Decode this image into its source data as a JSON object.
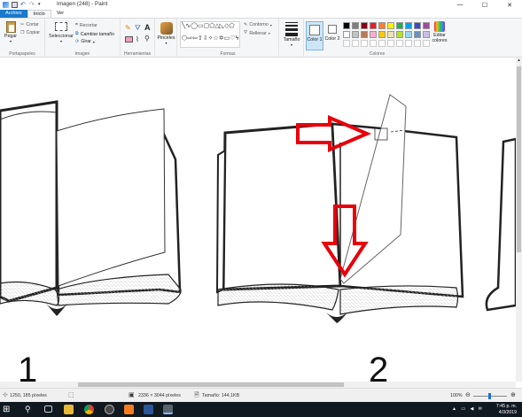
{
  "window": {
    "title": "Imagen (248) - Paint",
    "controls": {
      "minimize": "—",
      "maximize": "☐",
      "close": "✕"
    }
  },
  "tabs": {
    "file": "Archivo",
    "home": "Inicio",
    "view": "Ver"
  },
  "ribbon": {
    "clipboard": {
      "paste": "Pegar",
      "cut": "Cortar",
      "copy": "Copiar",
      "label": "Portapapeles"
    },
    "image": {
      "select": "Seleccionar",
      "crop": "Recortar",
      "resize": "Cambiar tamaño",
      "rotate": "Girar",
      "label": "Imagen"
    },
    "tools": {
      "label": "Herramientas"
    },
    "brushes": {
      "label": "Pinceles"
    },
    "shapes": {
      "outline": "Contorno",
      "fill": "Rellenar",
      "label": "Formas"
    },
    "size": {
      "label": "Tamaño"
    },
    "colors": {
      "color1": "Color 1",
      "color2": "Color 2",
      "edit": "Editar colores",
      "label": "Colores",
      "palette_row1": [
        "#000000",
        "#7f7f7f",
        "#880015",
        "#ed1c24",
        "#ff7f27",
        "#fff200",
        "#22b14c",
        "#00a2e8",
        "#3f48cc",
        "#a349a4"
      ],
      "palette_row2": [
        "#ffffff",
        "#c3c3c3",
        "#b97a57",
        "#ffaec9",
        "#ffc90e",
        "#efe4b0",
        "#b5e61d",
        "#99d9ea",
        "#7092be",
        "#c8bfe7"
      ]
    }
  },
  "canvas": {
    "label_1": "1",
    "label_2": "2",
    "arrow_color": "#e8000b"
  },
  "statusbar": {
    "position": "1250, 185 píxeles",
    "dimensions": "2336 × 3044 píxeles",
    "filesize": "Tamaño: 144,1KB",
    "zoom": "100%"
  },
  "taskbar": {
    "time": "7:45 p. m.",
    "date": "4/3/2019"
  }
}
